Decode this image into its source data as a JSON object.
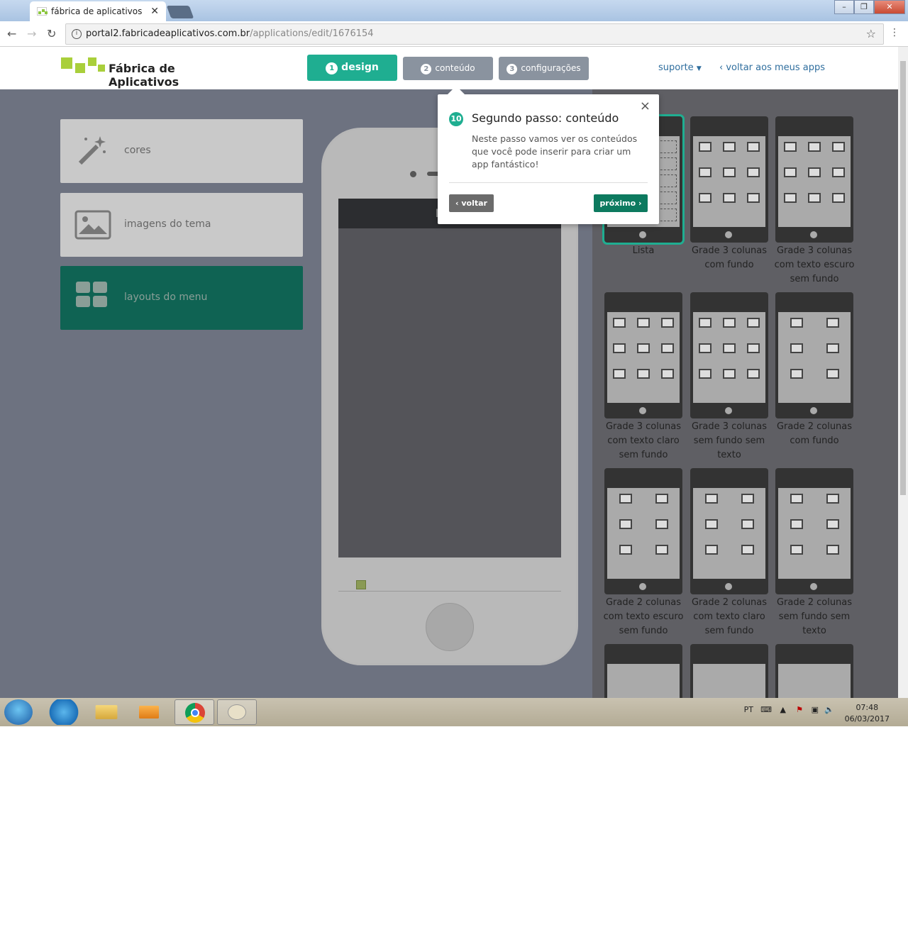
{
  "browser": {
    "tab_title": "fábrica de aplicativos",
    "url_host": "portal2.fabricadeaplicativos.com.br",
    "url_path": "/applications/edit/1676154"
  },
  "header": {
    "logo_text": "Fábrica de Aplicativos",
    "steps": [
      {
        "num": "1",
        "label": "design"
      },
      {
        "num": "2",
        "label": "conteúdo"
      },
      {
        "num": "3",
        "label": "configurações"
      }
    ],
    "support_label": "suporte",
    "back_apps_label": "voltar aos meus apps"
  },
  "sidebar": {
    "items": [
      {
        "label": "cores",
        "icon": "magic-wand-icon"
      },
      {
        "label": "imagens do tema",
        "icon": "image-icon"
      },
      {
        "label": "layouts do menu",
        "icon": "grid-icon"
      }
    ]
  },
  "preview": {
    "app_name_partial": "Nom"
  },
  "layouts": [
    {
      "caption": "Lista"
    },
    {
      "caption": "Grade 3 colunas com fundo"
    },
    {
      "caption": "Grade 3 colunas com texto escuro sem fundo"
    },
    {
      "caption": "Grade 3 colunas com texto claro sem fundo"
    },
    {
      "caption": "Grade 3 colunas sem fundo sem texto"
    },
    {
      "caption": "Grade 2 colunas com fundo"
    },
    {
      "caption": "Grade 2 colunas com texto escuro sem fundo"
    },
    {
      "caption": "Grade 2 colunas com texto claro sem fundo"
    },
    {
      "caption": "Grade 2 colunas sem fundo sem texto"
    }
  ],
  "popover": {
    "step_number": "10",
    "title": "Segundo passo: conteúdo",
    "text": "Neste passo vamos ver os conteúdos que você pode inserir para criar um app fantástico!",
    "back_label": "voltar",
    "next_label": "próximo"
  },
  "taskbar": {
    "language": "PT",
    "time": "07:48",
    "date": "06/03/2017"
  },
  "colors": {
    "accent": "#1fae91",
    "step_inactive": "#8a939f",
    "link": "#2f6e9e"
  }
}
